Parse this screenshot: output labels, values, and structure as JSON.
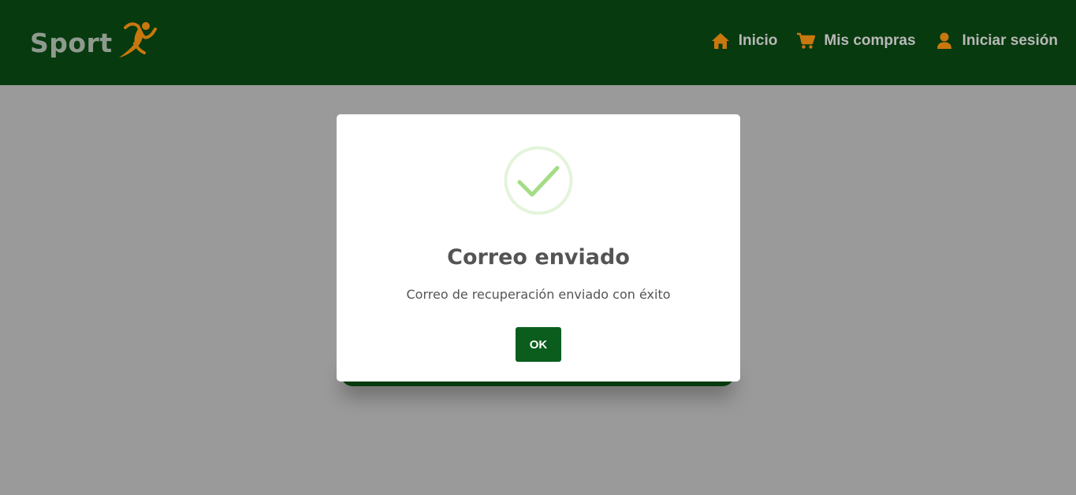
{
  "header": {
    "logo_text": "Sport",
    "nav": [
      {
        "label": "Inicio",
        "icon": "home-icon"
      },
      {
        "label": "Mis compras",
        "icon": "cart-icon"
      },
      {
        "label": "Iniciar sesión",
        "icon": "user-icon"
      }
    ]
  },
  "modal": {
    "icon": "check-icon",
    "title": "Correo enviado",
    "text": "Correo de recuperación enviado con éxito",
    "ok_label": "OK"
  },
  "colors": {
    "header_bg": "#073a0e",
    "accent_orange": "#c8780f",
    "button_green": "#0b5d1e",
    "success_green": "#a5dc86",
    "overlay": "#9a9a9a"
  }
}
